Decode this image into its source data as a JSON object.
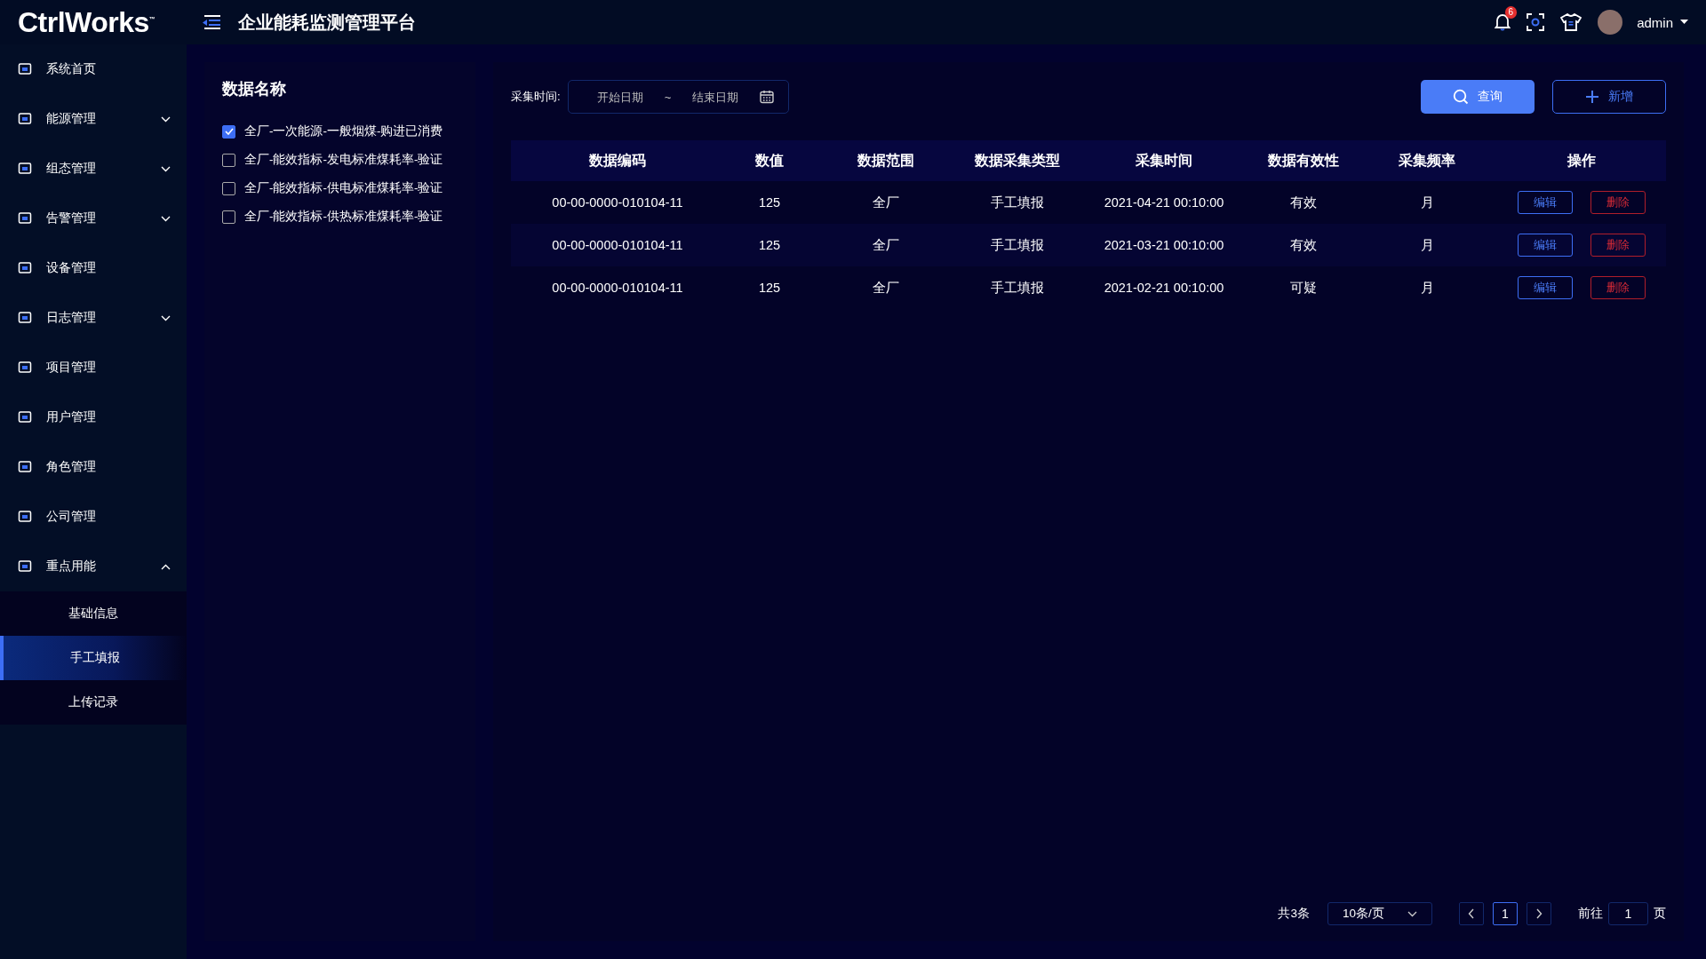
{
  "header": {
    "logo": "CtrlWorks",
    "logo_mark": "™",
    "title": "企业能耗监测管理平台",
    "notifications": "6",
    "user": "admin"
  },
  "sidebar": {
    "items": [
      {
        "label": "系统首页",
        "kind": "link"
      },
      {
        "label": "能源管理",
        "kind": "group",
        "expanded": false
      },
      {
        "label": "组态管理",
        "kind": "group",
        "expanded": false
      },
      {
        "label": "告警管理",
        "kind": "group",
        "expanded": false
      },
      {
        "label": "设备管理",
        "kind": "link"
      },
      {
        "label": "日志管理",
        "kind": "group",
        "expanded": false
      },
      {
        "label": "项目管理",
        "kind": "link"
      },
      {
        "label": "用户管理",
        "kind": "link"
      },
      {
        "label": "角色管理",
        "kind": "link"
      },
      {
        "label": "公司管理",
        "kind": "link"
      },
      {
        "label": "重点用能",
        "kind": "group",
        "expanded": true,
        "children": [
          {
            "label": "基础信息",
            "selected": false
          },
          {
            "label": "手工填报",
            "selected": true
          },
          {
            "label": "上传记录",
            "selected": false
          }
        ]
      }
    ]
  },
  "data_names": {
    "title": "数据名称",
    "items": [
      {
        "label": "全厂-一次能源-一般烟煤-购进已消费",
        "checked": true
      },
      {
        "label": "全厂-能效指标-发电标准煤耗率-验证",
        "checked": false
      },
      {
        "label": "全厂-能效指标-供电标准煤耗率-验证",
        "checked": false
      },
      {
        "label": "全厂-能效指标-供热标准煤耗率-验证",
        "checked": false
      }
    ]
  },
  "filter": {
    "label": "采集时间:",
    "start_placeholder": "开始日期",
    "separator": "~",
    "end_placeholder": "结束日期",
    "query_button": "查询",
    "add_button": "新增"
  },
  "table": {
    "columns": [
      "数据编码",
      "数值",
      "数据范围",
      "数据采集类型",
      "采集时间",
      "数据有效性",
      "采集频率",
      "操作"
    ],
    "rows": [
      {
        "cells": [
          "00-00-0000-010104-11",
          "125",
          "全厂",
          "手工填报",
          "2021-04-21 00:10:00",
          "有效",
          "月"
        ],
        "actions": [
          "编辑",
          "删除"
        ]
      },
      {
        "cells": [
          "00-00-0000-010104-11",
          "125",
          "全厂",
          "手工填报",
          "2021-03-21 00:10:00",
          "有效",
          "月"
        ],
        "actions": [
          "编辑",
          "删除"
        ]
      },
      {
        "cells": [
          "00-00-0000-010104-11",
          "125",
          "全厂",
          "手工填报",
          "2021-02-21 00:10:00",
          "可疑",
          "月"
        ],
        "actions": [
          "编辑",
          "删除"
        ]
      }
    ]
  },
  "pagination": {
    "total": "共3条",
    "page_size": "10条/页",
    "pages": [
      {
        "label": "1",
        "selected": true
      }
    ],
    "goto_label": "前往",
    "goto_value": "1",
    "goto_suffix": "页"
  }
}
